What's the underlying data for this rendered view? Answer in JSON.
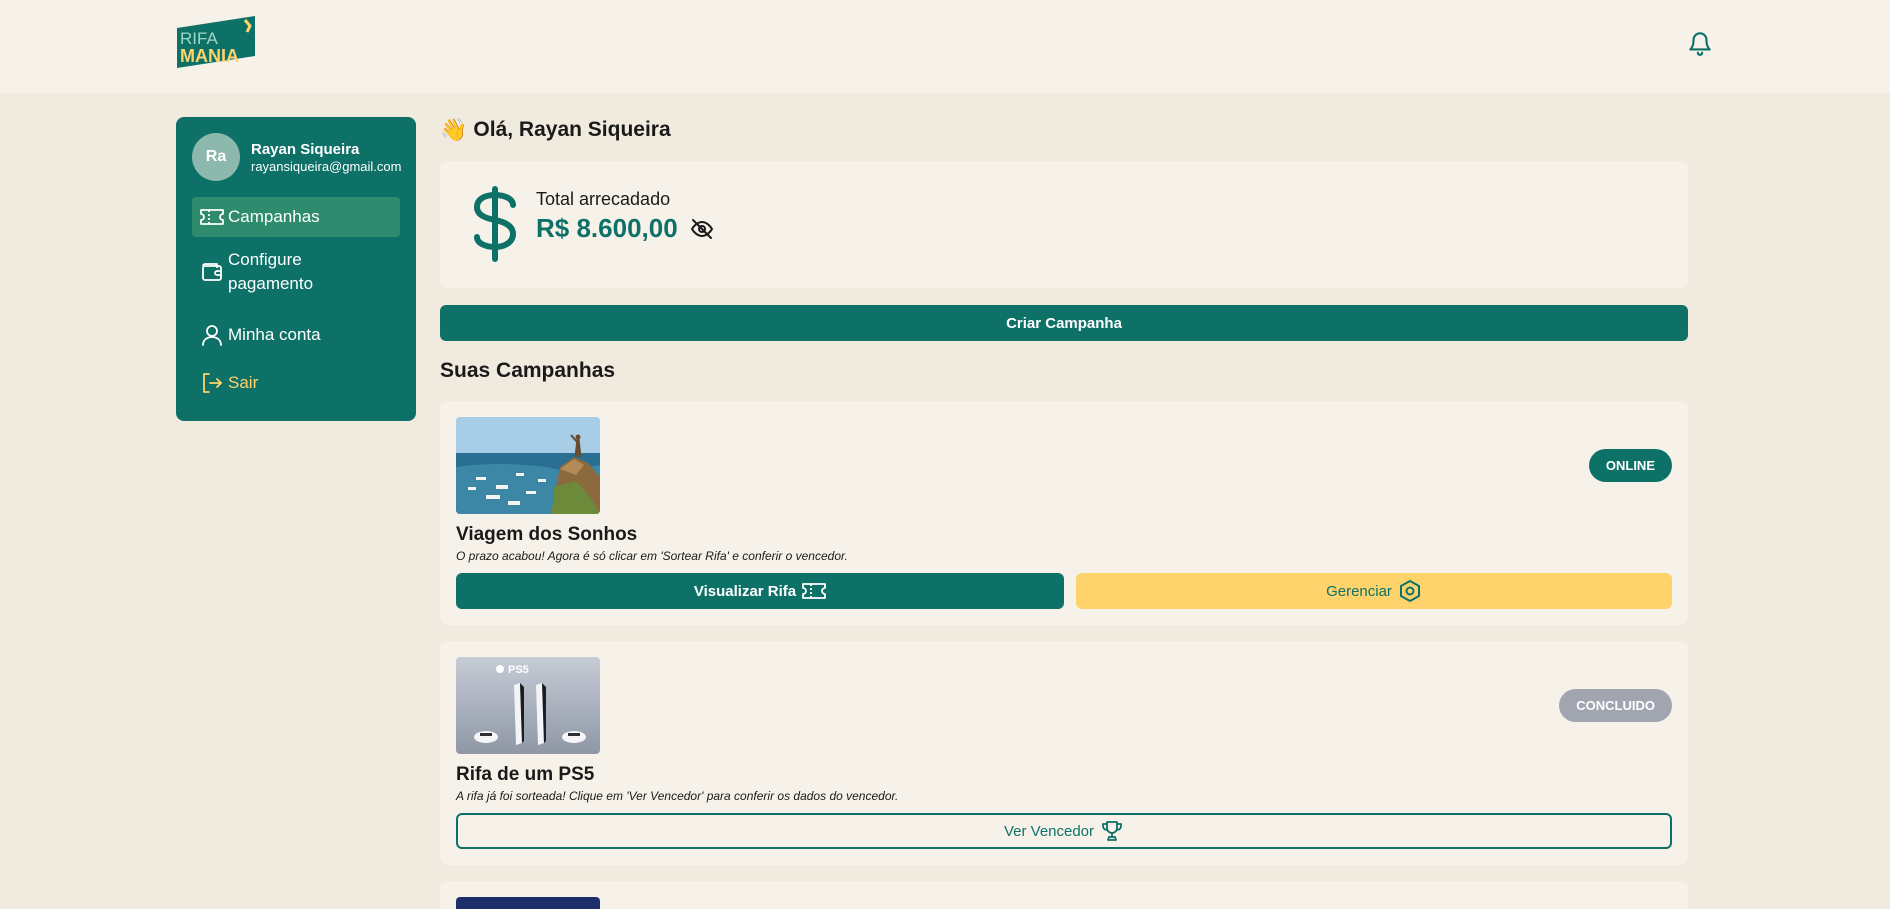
{
  "header": {
    "logo_text_top": "RIFA",
    "logo_text_bottom": "MANIA"
  },
  "sidebar": {
    "avatar_initials": "Ra",
    "user_name": "Rayan Siqueira",
    "user_email": "rayansiqueira@gmail.com",
    "items": [
      {
        "label": "Campanhas",
        "icon": "ticket-icon",
        "active": true
      },
      {
        "label": "Configure pagamento",
        "icon": "wallet-icon"
      },
      {
        "label": "Minha conta",
        "icon": "user-icon"
      },
      {
        "label": "Sair",
        "icon": "logout-icon"
      }
    ]
  },
  "main": {
    "greeting_emoji": "👋",
    "greeting": "Olá, Rayan Siqueira",
    "total_label": "Total arrecadado",
    "total_value": "R$ 8.600,00",
    "create_button": "Criar Campanha",
    "section_title": "Suas Campanhas"
  },
  "campaigns": [
    {
      "title": "Viagem dos Sonhos",
      "description": "O prazo acabou! Agora é só clicar em 'Sortear Rifa' e conferir o vencedor.",
      "status": "ONLINE",
      "view_button": "Visualizar Rifa",
      "manage_button": "Gerenciar"
    },
    {
      "title": "Rifa de um PS5",
      "description": "A rifa já foi sorteada! Clique em 'Ver Vencedor' para conferir os dados do vencedor.",
      "status": "CONCLUIDO",
      "image_text": "PS5",
      "winner_button": "Ver Vencedor"
    }
  ],
  "colors": {
    "primary": "#0e7168",
    "accent": "#ffd36b",
    "background": "#f1ebdf",
    "card": "#f6f2e9",
    "status_done": "#a1a5af"
  }
}
